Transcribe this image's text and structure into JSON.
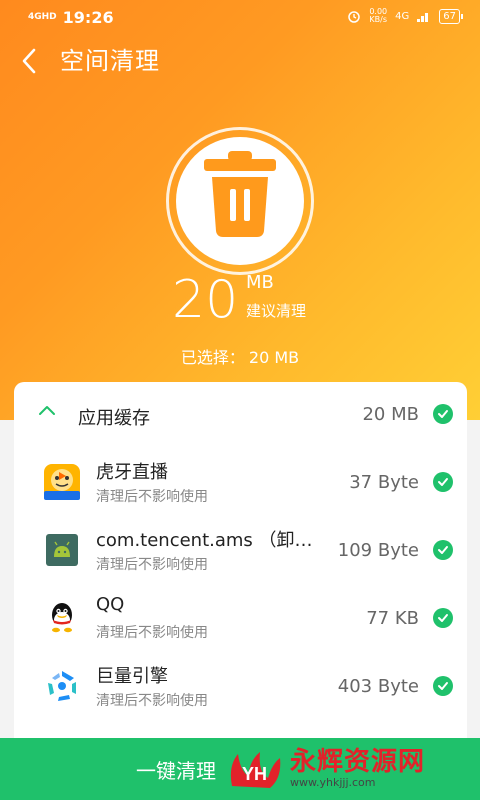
{
  "status_bar": {
    "network": "4GHD",
    "time": "19:26",
    "speed_value": "0.00",
    "speed_unit": "KB/s",
    "signal": "4G",
    "battery": "67"
  },
  "header": {
    "title": "空间清理",
    "back_icon": "back-arrow-icon"
  },
  "summary": {
    "amount": "20",
    "unit": "MB",
    "advice": "建议清理",
    "selected_label": "已选择：",
    "selected_value": "20 MB"
  },
  "group": {
    "label": "应用缓存",
    "size": "20 MB"
  },
  "items": [
    {
      "name": "虎牙直播",
      "sub": "清理后不影响使用",
      "size": "37 Byte",
      "icon": "huya-app-icon"
    },
    {
      "name": "com.tencent.ams （卸…",
      "sub": "清理后不影响使用",
      "size": "109 Byte",
      "icon": "android-app-icon"
    },
    {
      "name": "QQ",
      "sub": "清理后不影响使用",
      "size": "77 KB",
      "icon": "qq-app-icon"
    },
    {
      "name": "巨量引擎",
      "sub": "清理后不影响使用",
      "size": "403 Byte",
      "icon": "ocean-engine-app-icon"
    }
  ],
  "bottom": {
    "clean_label": "一键清理"
  },
  "watermark": {
    "title": "永辉资源网",
    "url": "www.yhkjjj.com"
  },
  "colors": {
    "accent": "#1fc16b",
    "hero_start": "#ff8a1e",
    "hero_end": "#ffcf35",
    "trash": "#ff9a1c"
  }
}
